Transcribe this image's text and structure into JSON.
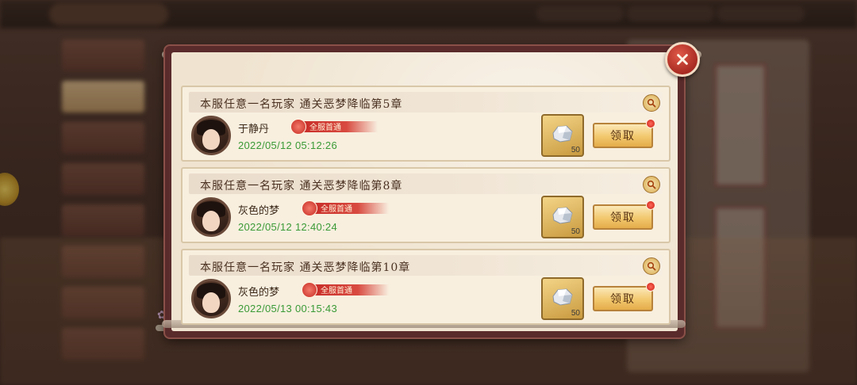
{
  "popup": {
    "entries": [
      {
        "title": "本服任意一名玩家  通关恶梦降临第5章",
        "player_name": "于静丹",
        "badge": "全服首通",
        "timestamp": "2022/05/12  05:12:26",
        "reward_qty": "50",
        "claim_label": "领取"
      },
      {
        "title": "本服任意一名玩家  通关恶梦降临第8章",
        "player_name": "灰色的梦",
        "badge": "全服首通",
        "timestamp": "2022/05/12  12:40:24",
        "reward_qty": "50",
        "claim_label": "领取"
      },
      {
        "title": "本服任意一名玩家  通关恶梦降临第10章",
        "player_name": "灰色的梦",
        "badge": "全服首通",
        "timestamp": "2022/05/13  00:15:43",
        "reward_qty": "50",
        "claim_label": "领取"
      }
    ]
  },
  "colors": {
    "frame": "#5a2b2b",
    "panel": "#f0e4d0",
    "timestamp_green": "#3a9a36",
    "claim_button": "#f2c86e",
    "badge_red": "#c82c28"
  },
  "icons": {
    "close": "close-icon",
    "magnify": "magnify-icon",
    "reward": "silver-ore-icon",
    "notification": "red-dot-icon"
  }
}
